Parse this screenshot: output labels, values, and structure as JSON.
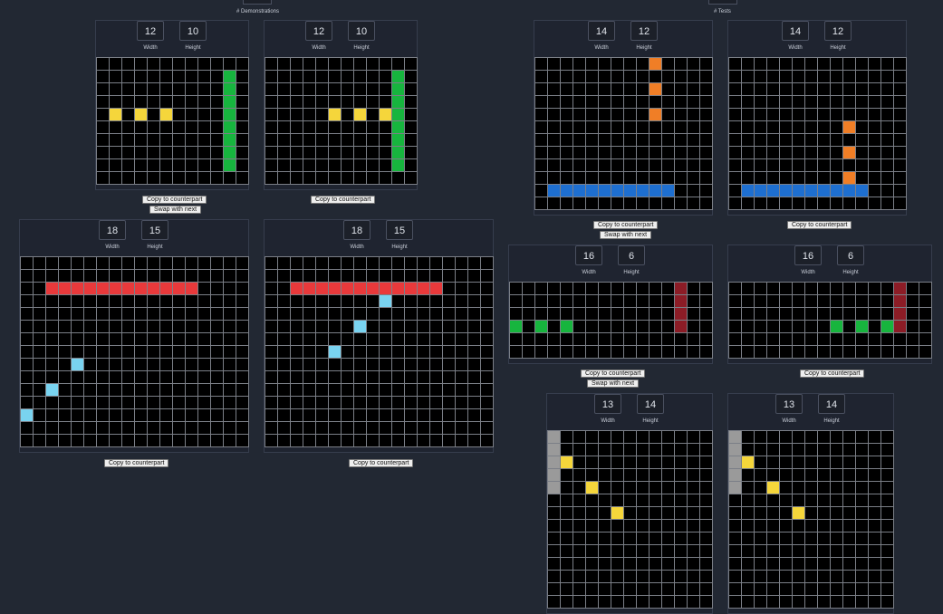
{
  "sections": {
    "demonstrations_label": "# Demonstrations",
    "tests_label": "# Tests"
  },
  "labels": {
    "width": "Width",
    "height": "Height"
  },
  "buttons": {
    "copy": "Copy to counterpart",
    "swap": "Swap with next"
  },
  "palette": {
    "0": "#000000",
    "1": "#1e6fd0",
    "2": "#e8393b",
    "3": "#17b53e",
    "4": "#f5d63b",
    "5": "#9a9a9a",
    "7": "#f07e26",
    "8": "#79d3f0",
    "9": "#8c1c26"
  },
  "grids": [
    {
      "id": "demo1-input",
      "width": "12",
      "height": "10",
      "cells": [
        [
          4,
          1,
          4
        ],
        [
          4,
          3,
          4
        ],
        [
          4,
          5,
          4
        ],
        [
          1,
          10,
          3
        ],
        [
          2,
          10,
          3
        ],
        [
          3,
          10,
          3
        ],
        [
          4,
          10,
          3
        ],
        [
          5,
          10,
          3
        ],
        [
          6,
          10,
          3
        ],
        [
          7,
          10,
          3
        ],
        [
          8,
          10,
          3
        ]
      ]
    },
    {
      "id": "demo1-output",
      "width": "12",
      "height": "10",
      "cells": [
        [
          4,
          5,
          4
        ],
        [
          4,
          7,
          4
        ],
        [
          4,
          9,
          4
        ],
        [
          1,
          10,
          3
        ],
        [
          2,
          10,
          3
        ],
        [
          3,
          10,
          3
        ],
        [
          4,
          10,
          3
        ],
        [
          5,
          10,
          3
        ],
        [
          6,
          10,
          3
        ],
        [
          7,
          10,
          3
        ],
        [
          8,
          10,
          3
        ]
      ]
    },
    {
      "id": "demo2-input",
      "width": "18",
      "height": "15",
      "cells": [
        [
          2,
          2,
          2
        ],
        [
          2,
          3,
          2
        ],
        [
          2,
          4,
          2
        ],
        [
          2,
          5,
          2
        ],
        [
          2,
          6,
          2
        ],
        [
          2,
          7,
          2
        ],
        [
          2,
          8,
          2
        ],
        [
          2,
          9,
          2
        ],
        [
          2,
          10,
          2
        ],
        [
          2,
          11,
          2
        ],
        [
          2,
          12,
          2
        ],
        [
          2,
          13,
          2
        ],
        [
          8,
          4,
          8
        ],
        [
          10,
          2,
          8
        ],
        [
          12,
          0,
          8
        ]
      ]
    },
    {
      "id": "demo2-output",
      "width": "18",
      "height": "15",
      "cells": [
        [
          2,
          2,
          2
        ],
        [
          2,
          3,
          2
        ],
        [
          2,
          4,
          2
        ],
        [
          2,
          5,
          2
        ],
        [
          2,
          6,
          2
        ],
        [
          2,
          7,
          2
        ],
        [
          2,
          8,
          2
        ],
        [
          2,
          9,
          2
        ],
        [
          2,
          10,
          2
        ],
        [
          2,
          11,
          2
        ],
        [
          2,
          12,
          2
        ],
        [
          2,
          13,
          2
        ],
        [
          3,
          9,
          8
        ],
        [
          5,
          7,
          8
        ],
        [
          7,
          5,
          8
        ]
      ]
    },
    {
      "id": "test1-input",
      "width": "14",
      "height": "12",
      "cells": [
        [
          0,
          9,
          7
        ],
        [
          2,
          9,
          7
        ],
        [
          4,
          9,
          7
        ],
        [
          10,
          1,
          1
        ],
        [
          10,
          2,
          1
        ],
        [
          10,
          3,
          1
        ],
        [
          10,
          4,
          1
        ],
        [
          10,
          5,
          1
        ],
        [
          10,
          6,
          1
        ],
        [
          10,
          7,
          1
        ],
        [
          10,
          8,
          1
        ],
        [
          10,
          9,
          1
        ],
        [
          10,
          10,
          1
        ]
      ]
    },
    {
      "id": "test1-output",
      "width": "14",
      "height": "12",
      "cells": [
        [
          5,
          9,
          7
        ],
        [
          7,
          9,
          7
        ],
        [
          9,
          9,
          7
        ],
        [
          10,
          1,
          1
        ],
        [
          10,
          2,
          1
        ],
        [
          10,
          3,
          1
        ],
        [
          10,
          4,
          1
        ],
        [
          10,
          5,
          1
        ],
        [
          10,
          6,
          1
        ],
        [
          10,
          7,
          1
        ],
        [
          10,
          8,
          1
        ],
        [
          10,
          9,
          1
        ],
        [
          10,
          10,
          1
        ]
      ]
    },
    {
      "id": "test2-input",
      "width": "16",
      "height": "6",
      "cells": [
        [
          0,
          13,
          9
        ],
        [
          1,
          13,
          9
        ],
        [
          2,
          13,
          9
        ],
        [
          3,
          13,
          9
        ],
        [
          3,
          0,
          3
        ],
        [
          3,
          2,
          3
        ],
        [
          3,
          4,
          3
        ]
      ]
    },
    {
      "id": "test2-output",
      "width": "16",
      "height": "6",
      "cells": [
        [
          0,
          13,
          9
        ],
        [
          1,
          13,
          9
        ],
        [
          2,
          13,
          9
        ],
        [
          3,
          13,
          9
        ],
        [
          3,
          8,
          3
        ],
        [
          3,
          10,
          3
        ],
        [
          3,
          12,
          3
        ]
      ]
    },
    {
      "id": "test3-input",
      "width": "13",
      "height": "14",
      "cells": [
        [
          0,
          0,
          5
        ],
        [
          1,
          0,
          5
        ],
        [
          2,
          0,
          5
        ],
        [
          3,
          0,
          5
        ],
        [
          4,
          0,
          5
        ],
        [
          2,
          1,
          4
        ],
        [
          4,
          3,
          4
        ],
        [
          6,
          5,
          4
        ]
      ]
    },
    {
      "id": "test3-output",
      "width": "13",
      "height": "14",
      "cells": [
        [
          0,
          0,
          5
        ],
        [
          1,
          0,
          5
        ],
        [
          2,
          0,
          5
        ],
        [
          3,
          0,
          5
        ],
        [
          4,
          0,
          5
        ],
        [
          2,
          1,
          4
        ],
        [
          4,
          3,
          4
        ],
        [
          6,
          5,
          4
        ]
      ]
    }
  ]
}
